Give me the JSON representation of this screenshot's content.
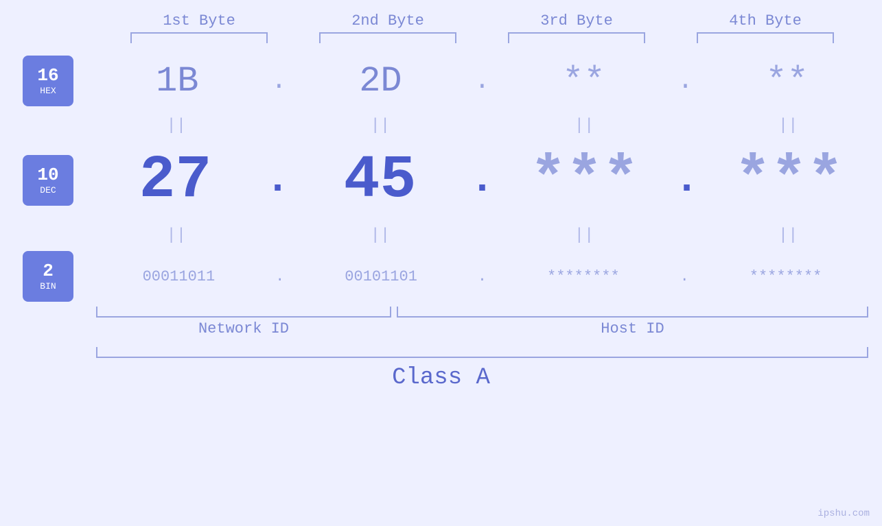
{
  "header": {
    "byte1": "1st Byte",
    "byte2": "2nd Byte",
    "byte3": "3rd Byte",
    "byte4": "4th Byte"
  },
  "badges": {
    "hex": {
      "num": "16",
      "label": "HEX"
    },
    "dec": {
      "num": "10",
      "label": "DEC"
    },
    "bin": {
      "num": "2",
      "label": "BIN"
    }
  },
  "hex_row": {
    "b1": "1B",
    "b2": "2D",
    "b3": "**",
    "b4": "**",
    "dots": [
      ".",
      ".",
      ".",
      "."
    ]
  },
  "dec_row": {
    "b1": "27",
    "b2": "45",
    "b3": "***",
    "b4": "***",
    "dots": [
      ".",
      ".",
      ".",
      "."
    ]
  },
  "bin_row": {
    "b1": "00011011",
    "b2": "00101101",
    "b3": "********",
    "b4": "********",
    "dots": [
      ".",
      ".",
      ".",
      "."
    ]
  },
  "equals": "||",
  "labels": {
    "network_id": "Network ID",
    "host_id": "Host ID",
    "class": "Class A"
  },
  "watermark": "ipshu.com"
}
